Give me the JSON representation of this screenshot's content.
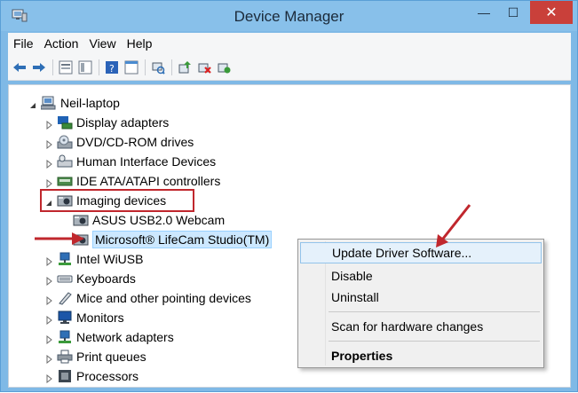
{
  "window": {
    "title": "Device Manager",
    "controls": {
      "minimize": "—",
      "maximize": "☐",
      "close": "✕"
    }
  },
  "menu": [
    "File",
    "Action",
    "View",
    "Help"
  ],
  "toolbar": {
    "icons": [
      "back-arrow-icon",
      "forward-arrow-icon",
      "properties-icon",
      "show-hide-icon",
      "help-icon",
      "console-view-icon",
      "scan-hardware-icon",
      "update-driver-icon",
      "uninstall-icon",
      "enable-icon"
    ]
  },
  "tree": {
    "root": "Neil-laptop",
    "items": [
      {
        "label": "Display adapters",
        "icon": "display-adapter-icon"
      },
      {
        "label": "DVD/CD-ROM drives",
        "icon": "dvd-drive-icon"
      },
      {
        "label": "Human Interface Devices",
        "icon": "hid-icon"
      },
      {
        "label": "IDE ATA/ATAPI controllers",
        "icon": "ide-controller-icon"
      },
      {
        "label": "Imaging devices",
        "icon": "camera-icon",
        "expanded": true,
        "children": [
          {
            "label": "ASUS USB2.0 Webcam",
            "icon": "camera-icon"
          },
          {
            "label": "Microsoft® LifeCam Studio(TM)",
            "icon": "camera-icon",
            "selected": true
          }
        ]
      },
      {
        "label": "Intel WiUSB",
        "icon": "network-icon"
      },
      {
        "label": "Keyboards",
        "icon": "keyboard-icon"
      },
      {
        "label": "Mice and other pointing devices",
        "icon": "mouse-icon"
      },
      {
        "label": "Monitors",
        "icon": "monitor-icon"
      },
      {
        "label": "Network adapters",
        "icon": "network-icon"
      },
      {
        "label": "Print queues",
        "icon": "printer-icon"
      },
      {
        "label": "Processors",
        "icon": "processor-icon"
      }
    ]
  },
  "context_menu": {
    "items": [
      "Update Driver Software...",
      "Disable",
      "Uninstall",
      "Scan for hardware changes",
      "Properties"
    ],
    "highlighted": "Update Driver Software...",
    "bold": "Properties"
  },
  "colors": {
    "title_bar": "#88c0ea",
    "close_button": "#c9403a",
    "annotation_red": "#c0272d",
    "selection": "#cce8ff",
    "menu_highlight": "#e5f1fb"
  }
}
